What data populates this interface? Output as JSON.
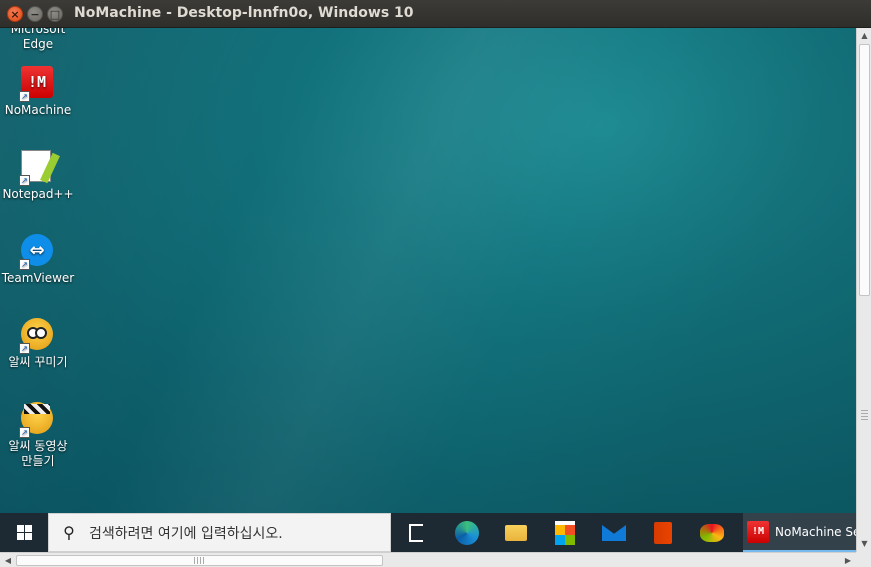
{
  "window": {
    "title": "NoMachine - Desktop-lnnfn0o, Windows 10",
    "close_icon": "close-icon",
    "minimize_icon": "minimize-icon",
    "maximize_icon": "maximize-icon"
  },
  "desktop": {
    "icons": [
      {
        "label": "Microsoft\nEdge",
        "icon": "edge-icon"
      },
      {
        "label": "NoMachine",
        "icon": "nomachine-icon",
        "glyph": "!M"
      },
      {
        "label": "Notepad++",
        "icon": "notepadpp-icon"
      },
      {
        "label": "TeamViewer",
        "icon": "teamviewer-icon",
        "glyph": "⇔"
      },
      {
        "label": "알씨 꾸미기",
        "icon": "alsee-decorate-icon"
      },
      {
        "label": "알씨 동영상\n만들기",
        "icon": "alsee-video-icon"
      }
    ]
  },
  "taskbar": {
    "search_placeholder": "검색하려면 여기에 입력하십시오.",
    "search_glyph": "⚲",
    "pinned": [
      "task-view-icon",
      "edge-icon",
      "file-explorer-icon",
      "store-icon",
      "mail-icon",
      "office-icon",
      "app-icon"
    ],
    "running_app": {
      "label": "NoMachine Se",
      "glyph": "!M"
    }
  },
  "scrollbars": {
    "up_arrow": "▲",
    "down_arrow": "▼",
    "left_arrow": "◀",
    "right_arrow": "▶"
  }
}
